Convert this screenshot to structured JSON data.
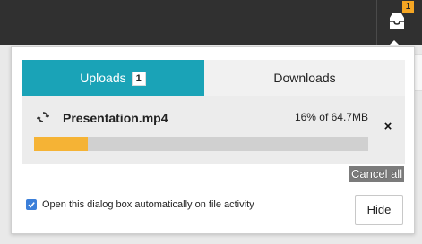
{
  "topbar": {
    "tray_badge": "1"
  },
  "dialog": {
    "tabs": [
      {
        "label": "Uploads",
        "count": "1",
        "active": true
      },
      {
        "label": "Downloads",
        "active": false
      }
    ],
    "upload": {
      "file_name": "Presentation.mp4",
      "progress_text": "16% of 64.7MB",
      "progress_fraction": 0.16,
      "remove_glyph": "×"
    },
    "cancel_all_label": "Cancel all",
    "auto_open_label": "Open this dialog box automatically on file activity",
    "auto_open_checked": true,
    "hide_label": "Hide"
  },
  "colors": {
    "accent": "#1aa3b7",
    "progress": "#f5b335",
    "badge": "#f5a623",
    "checkbox": "#3b7fd9"
  },
  "icons": [
    "inbox-tray-icon",
    "sync-spinner-icon",
    "close-icon",
    "checkmark-icon"
  ]
}
